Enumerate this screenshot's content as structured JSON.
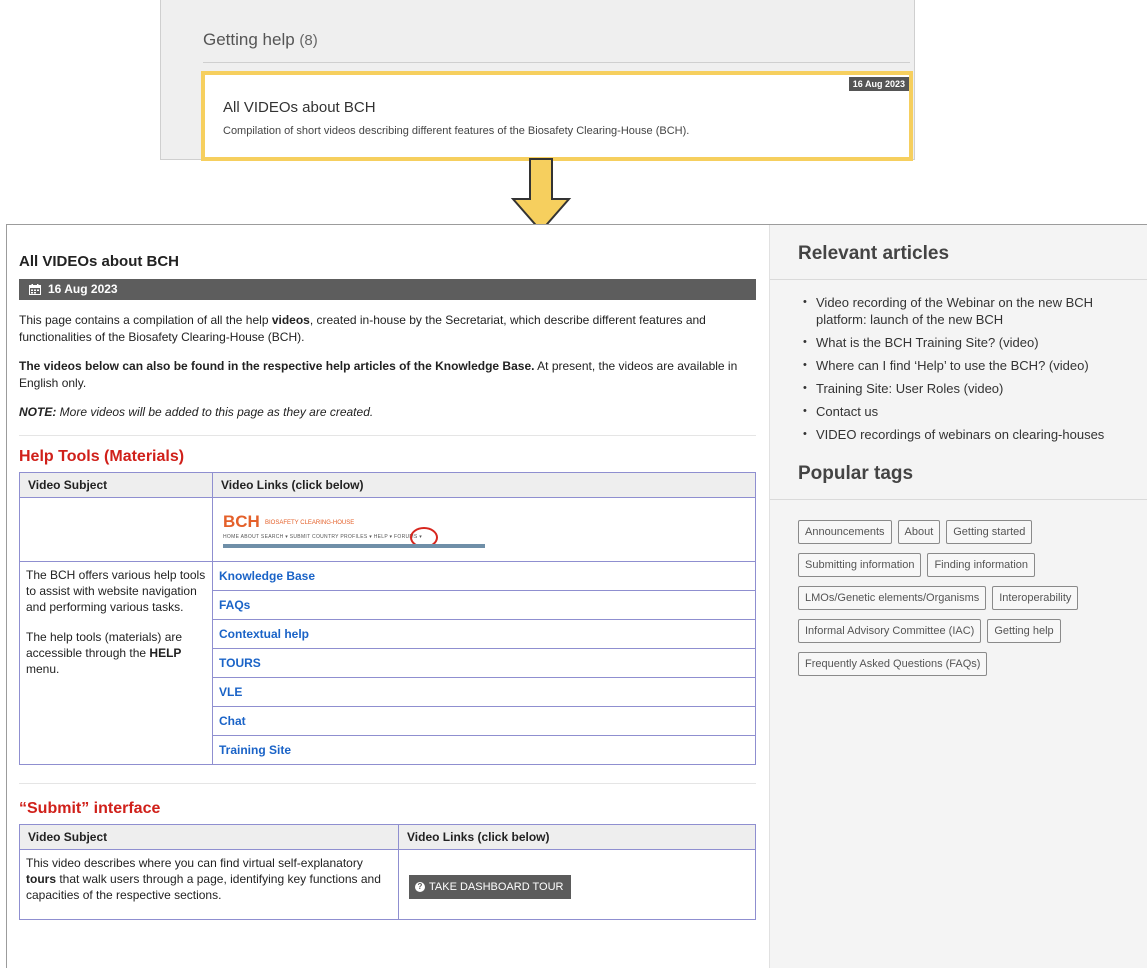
{
  "snippet": {
    "title": "Getting help",
    "count": "(8)",
    "card_date": "16 Aug 2023",
    "card_title": "All VIDEOs about BCH",
    "card_desc": "Compilation of short videos describing different features of the Biosafety Clearing-House (BCH)."
  },
  "arrow": {
    "icon": "arrow-down-icon",
    "color": "#f6cf5e"
  },
  "article": {
    "title": "All VIDEOs about BCH",
    "date": "16 Aug 2023",
    "date_icon": "calendar-icon",
    "p1_a": "This page contains a compilation of all the help ",
    "p1_bold": "videos",
    "p1_b": ", created in-house by the Secretariat, which describe different features and functionalities of the Biosafety Clearing-House (BCH).",
    "p2_bold": "The videos below can also be found in the respective help articles of the Knowledge Base.",
    "p2_rest": " At present, the videos are available in English only.",
    "note_label": "NOTE:",
    "note_text": " More videos will be added to this page as they are created.",
    "section1": {
      "heading": "Help Tools (Materials)",
      "col1": "Video Subject",
      "col2": "Video Links (click below)",
      "mini_logo": "BCH",
      "mini_tagline": "BIOSAFETY CLEARING-HOUSE",
      "mini_menu": "HOME   ABOUT   SEARCH ▾   SUBMIT   COUNTRY PROFILES ▾   HELP ▾   FORUMS ▾",
      "subject_p1": "The BCH offers various help tools to assist with website navigation and performing various tasks.",
      "subject_p2_a": "The help tools (materials) are accessible through the ",
      "subject_p2_bold": "HELP",
      "subject_p2_b": " menu.",
      "links": [
        "Knowledge Base",
        "FAQs",
        "Contextual help",
        "TOURS",
        "VLE",
        "Chat",
        "Training Site"
      ]
    },
    "section2": {
      "heading": "“Submit” interface",
      "col1": "Video Subject",
      "col2": "Video Links (click below)",
      "subject_a": "This video describes where you can find virtual self-explanatory ",
      "subject_bold": "tours",
      "subject_b": " that walk users through a page, identifying key functions and capacities of the respective sections.",
      "button_label": "TAKE DASHBOARD TOUR"
    }
  },
  "sidebar": {
    "relevant_heading": "Relevant articles",
    "articles": [
      "Video recording of the Webinar on the new BCH platform: launch of the new BCH",
      "What is the BCH Training Site? (video)",
      "Where can I find ‘Help’ to use the BCH? (video)",
      "Training Site: User Roles (video)",
      "Contact us",
      "VIDEO recordings of webinars on clearing-houses"
    ],
    "tags_heading": "Popular tags",
    "tags": [
      "Announcements",
      "About",
      "Getting started",
      "Submitting information",
      "Finding information",
      "LMOs/Genetic elements/Organisms",
      "Interoperability",
      "Informal Advisory Committee (IAC)",
      "Getting help",
      "Frequently Asked Questions (FAQs)"
    ]
  }
}
